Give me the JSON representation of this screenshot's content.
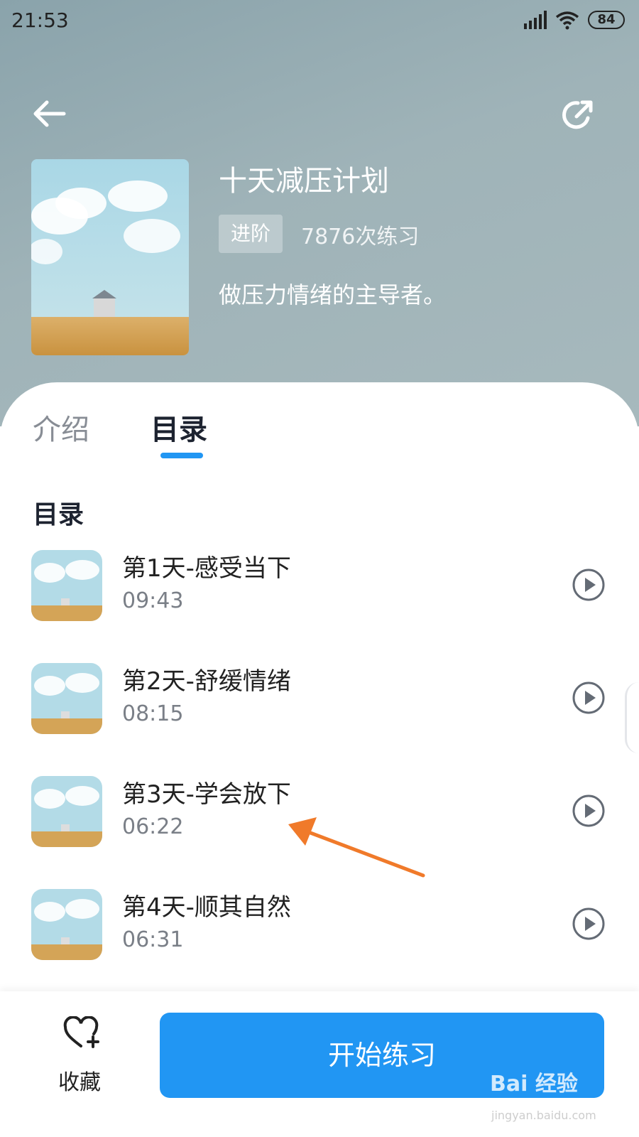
{
  "status_bar": {
    "time": "21:53",
    "battery": "84"
  },
  "header": {
    "title": "十天减压计划",
    "level_badge": "进阶",
    "practice_count": "7876次练习",
    "description": "做压力情绪的主导者。"
  },
  "tabs": [
    {
      "label": "介绍",
      "active": false
    },
    {
      "label": "目录",
      "active": true
    }
  ],
  "section_title": "目录",
  "lessons": [
    {
      "title": "第1天-感受当下",
      "duration": "09:43"
    },
    {
      "title": "第2天-舒缓情绪",
      "duration": "08:15"
    },
    {
      "title": "第3天-学会放下",
      "duration": "06:22"
    },
    {
      "title": "第4天-顺其自然",
      "duration": "06:31"
    }
  ],
  "bottom": {
    "favorite_label": "收藏",
    "start_label": "开始练习"
  },
  "watermark": {
    "main": "Bai 经验",
    "sub": "jingyan.baidu.com"
  },
  "colors": {
    "accent": "#2196f3",
    "annotation": "#f07a2a"
  }
}
